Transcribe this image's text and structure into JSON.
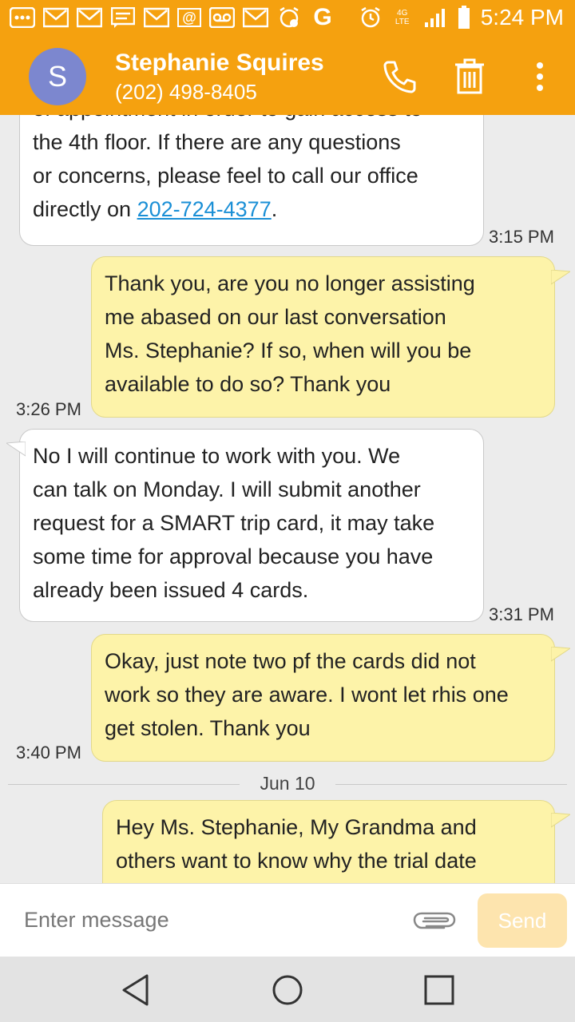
{
  "status_bar": {
    "time": "5:24 PM",
    "network": "4G LTE",
    "carrier_letter": "G",
    "email_letter": "@",
    "icons": [
      "more-icon",
      "gmail-icon",
      "gmail-icon",
      "message-icon",
      "gmail-icon",
      "email-icon",
      "voicemail-icon",
      "gmail-icon",
      "alarm-icon",
      "google-icon",
      "alarm-clock-icon",
      "signal-icon",
      "battery-icon"
    ]
  },
  "contact": {
    "initial": "S",
    "name": "Stephanie Squires",
    "phone": "(202) 498-8405"
  },
  "messages": [
    {
      "direction": "incoming",
      "lines": [
        "of appointment in order to gain access to",
        "the 4th floor.  If there are any questions",
        "or concerns, please feel to call our office"
      ],
      "last_line_prefix": "directly on ",
      "link": "202-724-4377",
      "last_line_suffix": ".",
      "time": "3:15 PM"
    },
    {
      "direction": "outgoing",
      "lines": [
        "Thank you, are you no longer assisting",
        "me abased on our last conversation",
        "Ms. Stephanie? If so, when will you be",
        "available to do so? Thank you"
      ],
      "time": "3:26 PM"
    },
    {
      "direction": "incoming",
      "lines": [
        "No I will continue to work with you. We",
        "can talk on Monday. I will submit another",
        "request for a SMART trip card, it may take",
        "some time for approval because you have",
        "already been issued 4 cards."
      ],
      "time": "3:31 PM"
    },
    {
      "direction": "outgoing",
      "lines": [
        "Okay, just note two pf the cards did not",
        "work so they are aware. I wont let rhis one",
        "get stolen. Thank you"
      ],
      "time": "3:40 PM"
    },
    {
      "direction": "outgoing",
      "lines": [
        "Hey Ms. Stephanie, My Grandma and",
        "others want to know why the trial date"
      ]
    }
  ],
  "date_separator": "Jun 10",
  "composer": {
    "placeholder": "Enter message",
    "send_label": "Send"
  },
  "colors": {
    "accent": "#f5a10f",
    "avatar": "#7c87cf",
    "outgoing_bubble": "#fdf3a9",
    "incoming_bubble": "#ffffff",
    "link": "#1a8fd6",
    "send_disabled": "#fde4ae"
  }
}
